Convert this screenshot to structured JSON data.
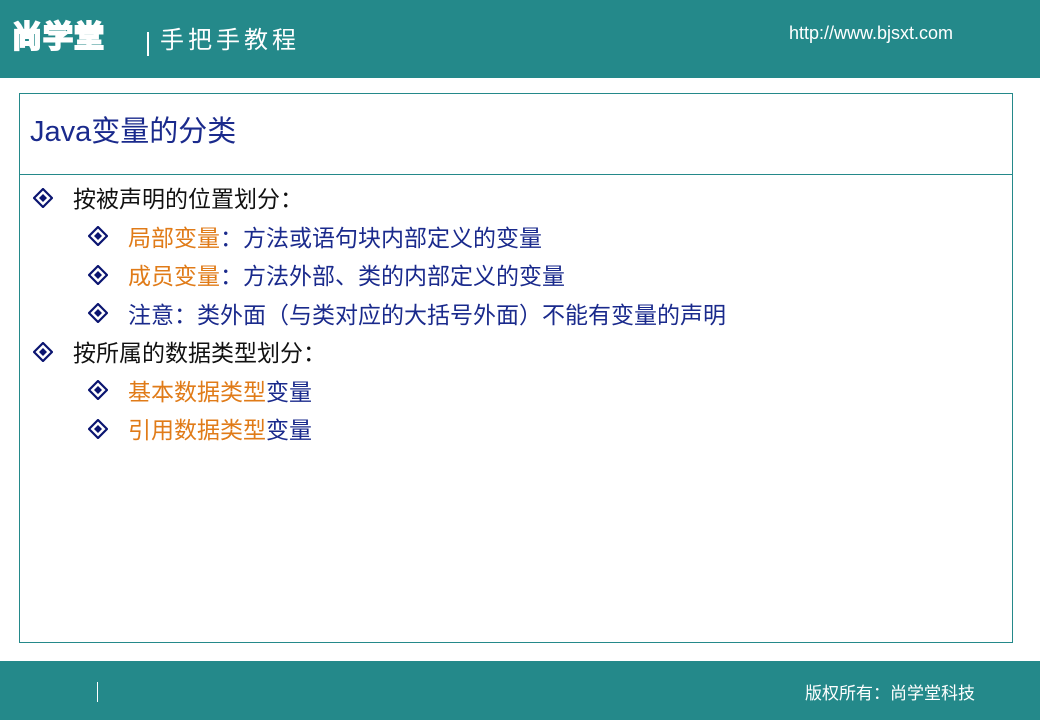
{
  "header": {
    "logo_text": "尚学堂",
    "tagline": "手把手教程",
    "url": "http://www.bjsxt.com"
  },
  "slide": {
    "title": "Java变量的分类",
    "bullets": [
      {
        "level": 1,
        "parts": [
          {
            "text": "按被声明的位置划分：",
            "color": "dark"
          }
        ]
      },
      {
        "level": 2,
        "parts": [
          {
            "text": "局部变量",
            "color": "orange"
          },
          {
            "text": "：方法或语句块内部定义的变量",
            "color": "blue"
          }
        ]
      },
      {
        "level": 2,
        "parts": [
          {
            "text": "成员变量",
            "color": "orange"
          },
          {
            "text": "：方法外部、类的内部定义的变量",
            "color": "blue"
          }
        ]
      },
      {
        "level": 2,
        "parts": [
          {
            "text": "注意：类外面（与类对应的大括号外面）不能有变量的声明",
            "color": "blue"
          }
        ]
      },
      {
        "level": 1,
        "parts": [
          {
            "text": "按所属的数据类型划分：",
            "color": "dark"
          }
        ]
      },
      {
        "level": 2,
        "parts": [
          {
            "text": "基本数据类型",
            "color": "orange"
          },
          {
            "text": "变量",
            "color": "blue"
          }
        ]
      },
      {
        "level": 2,
        "parts": [
          {
            "text": "引用数据类型",
            "color": "orange"
          },
          {
            "text": "变量",
            "color": "blue"
          }
        ]
      }
    ]
  },
  "footer": {
    "copyright": "版权所有：尚学堂科技"
  },
  "colors": {
    "teal": "#24898a",
    "title_blue": "#1a2a8c",
    "orange": "#e07b18",
    "bullet_icon": "#0a1470"
  },
  "icons": {
    "bullet": "diamond-bullet-icon"
  }
}
